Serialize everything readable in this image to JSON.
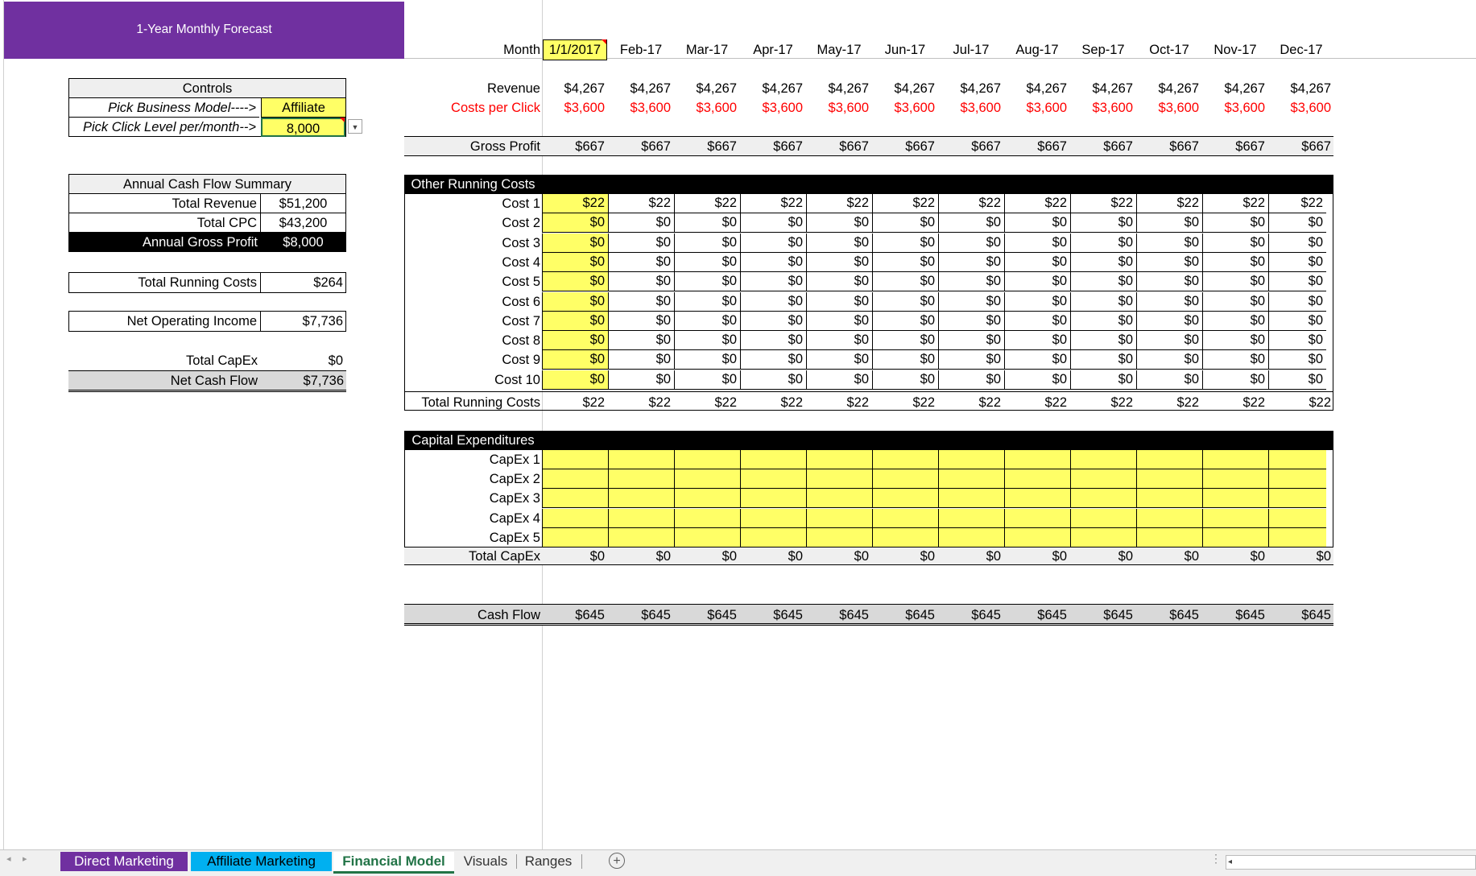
{
  "title": "1-Year Monthly Forecast",
  "months": [
    "1/1/2017",
    "Feb-17",
    "Mar-17",
    "Apr-17",
    "May-17",
    "Jun-17",
    "Jul-17",
    "Aug-17",
    "Sep-17",
    "Oct-17",
    "Nov-17",
    "Dec-17"
  ],
  "month_label": "Month",
  "controls": {
    "header": "Controls",
    "business_model_label": "Pick Business Model---->",
    "business_model_value": "Affiliate",
    "click_level_label": "Pick Click Level per/month-->",
    "click_level_value": "8,000"
  },
  "summary": {
    "header": "Annual Cash Flow Summary",
    "total_revenue_label": "Total Revenue",
    "total_revenue": "$51,200",
    "total_cpc_label": "Total CPC",
    "total_cpc": "$43,200",
    "gross_profit_label": "Annual Gross Profit",
    "gross_profit": "$8,000",
    "running_costs_label": "Total Running Costs",
    "running_costs": "$264",
    "noi_label": "Net Operating Income",
    "noi": "$7,736",
    "capex_label": "Total CapEx",
    "capex": "$0",
    "net_cash_flow_label": "Net Cash Flow",
    "net_cash_flow": "$7,736"
  },
  "revenue": {
    "label": "Revenue",
    "values": [
      "$4,267",
      "$4,267",
      "$4,267",
      "$4,267",
      "$4,267",
      "$4,267",
      "$4,267",
      "$4,267",
      "$4,267",
      "$4,267",
      "$4,267",
      "$4,267"
    ]
  },
  "cpc": {
    "label": "Costs per Click",
    "values": [
      "$3,600",
      "$3,600",
      "$3,600",
      "$3,600",
      "$3,600",
      "$3,600",
      "$3,600",
      "$3,600",
      "$3,600",
      "$3,600",
      "$3,600",
      "$3,600"
    ]
  },
  "gross_profit": {
    "label": "Gross Profit",
    "values": [
      "$667",
      "$667",
      "$667",
      "$667",
      "$667",
      "$667",
      "$667",
      "$667",
      "$667",
      "$667",
      "$667",
      "$667"
    ]
  },
  "running": {
    "header": "Other Running Costs",
    "rows": [
      {
        "label": "Cost 1",
        "values": [
          "$22",
          "$22",
          "$22",
          "$22",
          "$22",
          "$22",
          "$22",
          "$22",
          "$22",
          "$22",
          "$22",
          "$22"
        ]
      },
      {
        "label": "Cost 2",
        "values": [
          "$0",
          "$0",
          "$0",
          "$0",
          "$0",
          "$0",
          "$0",
          "$0",
          "$0",
          "$0",
          "$0",
          "$0"
        ]
      },
      {
        "label": "Cost 3",
        "values": [
          "$0",
          "$0",
          "$0",
          "$0",
          "$0",
          "$0",
          "$0",
          "$0",
          "$0",
          "$0",
          "$0",
          "$0"
        ]
      },
      {
        "label": "Cost 4",
        "values": [
          "$0",
          "$0",
          "$0",
          "$0",
          "$0",
          "$0",
          "$0",
          "$0",
          "$0",
          "$0",
          "$0",
          "$0"
        ]
      },
      {
        "label": "Cost 5",
        "values": [
          "$0",
          "$0",
          "$0",
          "$0",
          "$0",
          "$0",
          "$0",
          "$0",
          "$0",
          "$0",
          "$0",
          "$0"
        ]
      },
      {
        "label": "Cost 6",
        "values": [
          "$0",
          "$0",
          "$0",
          "$0",
          "$0",
          "$0",
          "$0",
          "$0",
          "$0",
          "$0",
          "$0",
          "$0"
        ]
      },
      {
        "label": "Cost 7",
        "values": [
          "$0",
          "$0",
          "$0",
          "$0",
          "$0",
          "$0",
          "$0",
          "$0",
          "$0",
          "$0",
          "$0",
          "$0"
        ]
      },
      {
        "label": "Cost 8",
        "values": [
          "$0",
          "$0",
          "$0",
          "$0",
          "$0",
          "$0",
          "$0",
          "$0",
          "$0",
          "$0",
          "$0",
          "$0"
        ]
      },
      {
        "label": "Cost 9",
        "values": [
          "$0",
          "$0",
          "$0",
          "$0",
          "$0",
          "$0",
          "$0",
          "$0",
          "$0",
          "$0",
          "$0",
          "$0"
        ]
      },
      {
        "label": "Cost 10",
        "values": [
          "$0",
          "$0",
          "$0",
          "$0",
          "$0",
          "$0",
          "$0",
          "$0",
          "$0",
          "$0",
          "$0",
          "$0"
        ]
      }
    ],
    "total_label": "Total Running Costs",
    "total_values": [
      "$22",
      "$22",
      "$22",
      "$22",
      "$22",
      "$22",
      "$22",
      "$22",
      "$22",
      "$22",
      "$22",
      "$22"
    ]
  },
  "capex": {
    "header": "Capital Expenditures",
    "rows": [
      "CapEx 1",
      "CapEx 2",
      "CapEx 3",
      "CapEx 4",
      "CapEx 5"
    ],
    "total_label": "Total CapEx",
    "total_values": [
      "$0",
      "$0",
      "$0",
      "$0",
      "$0",
      "$0",
      "$0",
      "$0",
      "$0",
      "$0",
      "$0",
      "$0"
    ]
  },
  "cash_flow": {
    "label": "Cash Flow",
    "values": [
      "$645",
      "$645",
      "$645",
      "$645",
      "$645",
      "$645",
      "$645",
      "$645",
      "$645",
      "$645",
      "$645",
      "$645"
    ]
  },
  "tabs": [
    {
      "label": "Direct Marketing",
      "color": "#7030a0"
    },
    {
      "label": "Affiliate Marketing",
      "color": "#00b0f0"
    },
    {
      "label": "Financial Model",
      "active": true
    },
    {
      "label": "Visuals"
    },
    {
      "label": "Ranges"
    }
  ],
  "colors": {
    "purple": "#7030a0",
    "yellow": "#ffff66",
    "red": "#ff0000",
    "green_active": "#217346"
  }
}
